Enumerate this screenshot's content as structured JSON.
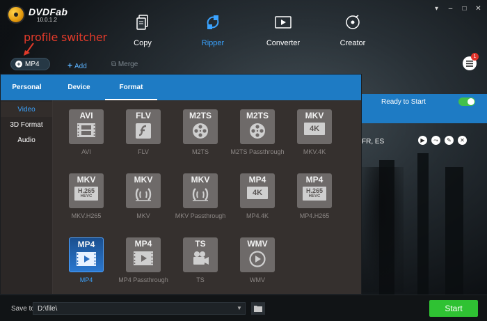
{
  "window_controls": [
    "▾",
    "–",
    "□",
    "✕"
  ],
  "logo": {
    "name": "DVDFab",
    "version": "10.0.1.2"
  },
  "annotation": {
    "text": "profile switcher",
    "color": "#e23a2a"
  },
  "modules": [
    {
      "label": "Copy",
      "icon": "copy-icon",
      "active": false
    },
    {
      "label": "Ripper",
      "icon": "ripper-icon",
      "active": true
    },
    {
      "label": "Converter",
      "icon": "converter-icon",
      "active": false
    },
    {
      "label": "Creator",
      "icon": "creator-icon",
      "active": false
    }
  ],
  "toolbar": {
    "profile": "MP4",
    "add": "Add",
    "merge": "Merge",
    "notification_count": "1"
  },
  "task": {
    "status": "Ready to Start",
    "languages": "FR, ES",
    "toggle_on": true
  },
  "profile_panel": {
    "tabs": [
      "Personal",
      "Device",
      "Format"
    ],
    "active_tab": "Format",
    "categories": [
      "Video",
      "3D Format",
      "Audio"
    ],
    "active_category": "Video",
    "formats": [
      {
        "tag": "AVI",
        "glyph": "film",
        "name": "AVI"
      },
      {
        "tag": "FLV",
        "glyph": "flash",
        "name": "FLV"
      },
      {
        "tag": "M2TS",
        "glyph": "reel",
        "name": "M2TS"
      },
      {
        "tag": "M2TS",
        "glyph": "reel",
        "name": "M2TS Passthrough"
      },
      {
        "tag": "MKV",
        "glyph": "4K",
        "name": "MKV.4K"
      },
      {
        "tag": "MKV",
        "glyph": "H.265",
        "name": "MKV.H265"
      },
      {
        "tag": "MKV",
        "glyph": "matroska",
        "name": "MKV"
      },
      {
        "tag": "MKV",
        "glyph": "matroska",
        "name": "MKV Passthrough"
      },
      {
        "tag": "MP4",
        "glyph": "4K",
        "name": "MP4.4K"
      },
      {
        "tag": "MP4",
        "glyph": "H.265",
        "name": "MP4.H265"
      },
      {
        "tag": "MP4",
        "glyph": "play-film",
        "name": "MP4",
        "selected": true
      },
      {
        "tag": "MP4",
        "glyph": "play-film",
        "name": "MP4 Passthrough"
      },
      {
        "tag": "TS",
        "glyph": "camera",
        "name": "TS"
      },
      {
        "tag": "WMV",
        "glyph": "play-circle",
        "name": "WMV"
      }
    ],
    "hevc_label": "HEVC"
  },
  "bottom": {
    "save_label": "Save to:",
    "save_path": "D:\\file\\",
    "start_label": "Start"
  },
  "colors": {
    "accent": "#1e7bc4",
    "active_text": "#3aa3ff",
    "start": "#2fc233",
    "badge": "#e0322a"
  }
}
